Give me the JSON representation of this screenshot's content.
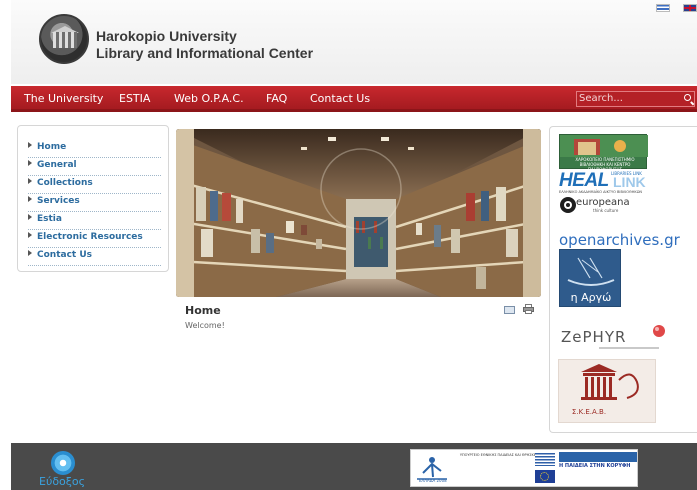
{
  "header": {
    "title_line1": "Harokopio University",
    "title_line2": "Library and Informational Center",
    "languages": [
      "greek-flag-icon",
      "english-flag-icon"
    ]
  },
  "nav": {
    "items": [
      "The University",
      "ESTIA",
      "Web O.P.A.C.",
      "FAQ",
      "Contact Us"
    ],
    "search_placeholder": "Search..."
  },
  "sidebar": {
    "items": [
      "Home",
      "General",
      "Collections",
      "Services",
      "Estia",
      "Electronic Resources",
      "Contact Us"
    ]
  },
  "content": {
    "title": "Home",
    "text": "Welcome!"
  },
  "links": {
    "harokopio": "ΧΑΡΟΚΟΠΕΙΟ ΠΑΝΕΠΙΣΤΗΜΙΟ ΒΙΒΛΙΟΘΗΚΗ ΚΑΙ ΚΕΝΤΡΟ ΠΛΗΡΟΦΟΡΗΣΗΣ",
    "heal_big": "HEAL",
    "heal_small": "LIBRARIES LINK",
    "heal_link": "LINK",
    "heal_sub": "ΕΛΛΗΝΙΚΟ ΑΚΑΔΗΜΑΪΚΟ ΔΙΚΤΥΟ ΒΙΒΛΙΟΘΗΚΩΝ",
    "europeana": "europeana",
    "europeana_sub": "think culture",
    "openarchives": "openarchives.gr",
    "argo": "η Αργώ",
    "zephyr": "ZePHYR",
    "skeab": "Σ.Κ.Ε.Α.Β."
  },
  "footer": {
    "eudoxus": "Εύδοξος",
    "espa_text": "ΥΠΟΥΡΓΕΙΟ ΕΘΝΙΚΗΣ ΠΑΙΔΕΙΑΣ ΚΑΙ ΘΡΗΣΚΕΥΜΑΤΩΝ",
    "espa_year": "ΕΛΛΑΔΑ 2008",
    "paideia": "Η ΠΑΙΔΕΙΑ ΣΤΗΝ ΚΟΡΥΦΗ"
  },
  "colors": {
    "nav_red": "#b8222a",
    "link_blue": "#2d6c9f",
    "footer_gray": "#4a4a4a"
  }
}
